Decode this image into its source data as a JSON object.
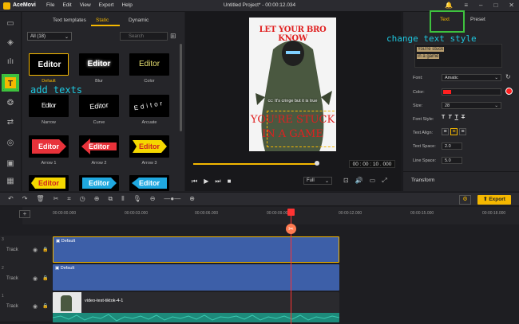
{
  "app": {
    "name": "AceMovi",
    "title": "Untitled Project* - 00:00:12.034"
  },
  "menu": [
    "File",
    "Edit",
    "View",
    "Export",
    "Help"
  ],
  "resource": {
    "tabs": [
      "Text templates",
      "Static",
      "Dynamic"
    ],
    "category": "All (18)",
    "search_placeholder": "Search",
    "tiles": [
      {
        "text": "Editor",
        "label": "Default"
      },
      {
        "text": "Editor",
        "label": "Blur"
      },
      {
        "text": "Editor",
        "label": "Color"
      },
      {
        "text": "Editor",
        "label": "Narrow"
      },
      {
        "text": "Editor",
        "label": "Curve"
      },
      {
        "text": "Editor",
        "label": "Arcuate"
      },
      {
        "text": "Editor",
        "label": "Arrow 1"
      },
      {
        "text": "Editor",
        "label": "Arrow 2"
      },
      {
        "text": "Editor",
        "label": "Arrow 3"
      },
      {
        "text": "Editor",
        "label": ""
      },
      {
        "text": "Editor",
        "label": ""
      },
      {
        "text": "Editor",
        "label": ""
      }
    ]
  },
  "annotations": {
    "add_texts": "add texts",
    "change_style": "change text style"
  },
  "preview": {
    "top_caption": "LET YOUR BRO KNOW",
    "subtitle": "cc: It's cringe but it is true",
    "main_text_1": "YOU'RE STUCK",
    "main_text_2": "IN A GAME",
    "timecode": "00 : 00 : 10 . 000",
    "quality": "Full",
    "progress": 0.98
  },
  "right": {
    "tabs": [
      "Text",
      "Preset"
    ],
    "text_preview_1": "You're stuck",
    "text_preview_2": "in a game",
    "font_label": "Font:",
    "font_value": "Amatic",
    "color_label": "Color:",
    "color_value": "#ff2020",
    "size_label": "Size:",
    "size_value": "28",
    "style_label": "Font Style:",
    "align_label": "Text Align:",
    "space_label": "Text Space:",
    "space_value": "2.0",
    "line_label": "Line Space:",
    "line_value": "5.0",
    "transform_label": "Transform"
  },
  "toolbar": {
    "export_label": "Export"
  },
  "timeline": {
    "ruler": [
      "00:00:00.000",
      "00:00:03.000",
      "00:00:06.000",
      "00:00:09.000",
      "00:00:12.000",
      "00:00:15.000",
      "00:00:18.000"
    ],
    "tracks": [
      {
        "num": "3",
        "label": "Track",
        "clip": "Default"
      },
      {
        "num": "2",
        "label": "Track",
        "clip": "Default"
      },
      {
        "num": "1",
        "label": "Track",
        "clip": "video-test-tiktok-4-1"
      }
    ]
  }
}
